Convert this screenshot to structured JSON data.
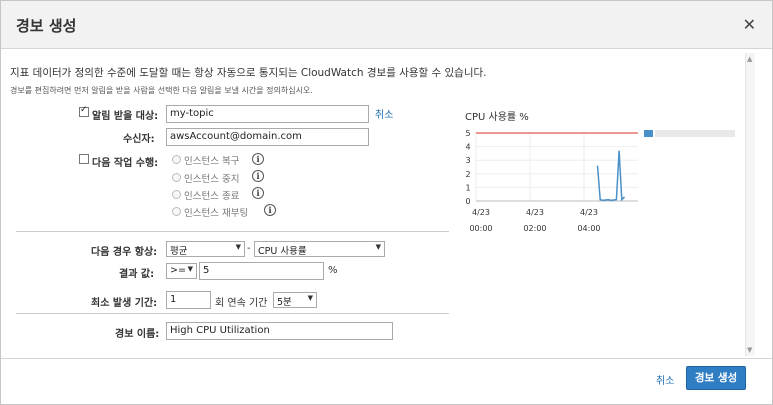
{
  "dialog": {
    "title": "경보 생성",
    "close_icon": "close-icon",
    "description": "지표 데이터가 정의한 수준에 도달할 때는 항상 자동으로 통지되는 CloudWatch 경보를 사용할 수 있습니다.",
    "sub_description": "경보를 편집하려면 먼저 알림을 받을 사람을 선택한 다음 알림을 보낼 시간을 정의하십시오."
  },
  "form": {
    "notify": {
      "label": "알림 받을 대상:",
      "checked": true,
      "value": "my-topic",
      "cancel_link": "취소"
    },
    "recipient": {
      "label": "수신자:",
      "value": "awsAccount@domain.com"
    },
    "action": {
      "label": "다음 작업 수행:",
      "checked": false,
      "options": [
        "인스턴스 복구",
        "인스턴스 중지",
        "인스턴스 종료",
        "인스턴스 재부팅"
      ]
    },
    "condition": {
      "label": "다음 경우 항상:",
      "statistic": "평균",
      "dash": "-",
      "metric": "CPU 사용률"
    },
    "threshold": {
      "label": "결과 값:",
      "operator": ">=",
      "value": "5",
      "unit": "%"
    },
    "period": {
      "label": "최소 발생 기간:",
      "value": "1",
      "middle_text": "회 연속 기간",
      "duration": "5분"
    },
    "name": {
      "label": "경보 이름:",
      "value": "High CPU Utilization"
    }
  },
  "chart_data": {
    "type": "line",
    "title": "CPU 사용률 %",
    "y_ticks": [
      "5",
      "4",
      "3",
      "2",
      "1",
      "0"
    ],
    "ylim": [
      0,
      5
    ],
    "x_ticks": [
      {
        "date": "4/23",
        "time": "00:00"
      },
      {
        "date": "4/23",
        "time": "02:00"
      },
      {
        "date": "4/23",
        "time": "04:00"
      }
    ],
    "threshold": 5,
    "threshold_color": "#e05a4e",
    "series_color": "#4a90c8",
    "series": [
      {
        "values": [
          [
            4.5,
            2.6
          ],
          [
            4.6,
            0.1
          ],
          [
            4.7,
            0.05
          ],
          [
            4.9,
            0.1
          ],
          [
            5.0,
            0.05
          ],
          [
            5.2,
            0.1
          ],
          [
            5.3,
            3.7
          ],
          [
            5.4,
            0.1
          ],
          [
            5.5,
            0.3
          ]
        ]
      }
    ],
    "grid": true
  },
  "footer": {
    "cancel_label": "취소",
    "create_label": "경보 생성"
  }
}
